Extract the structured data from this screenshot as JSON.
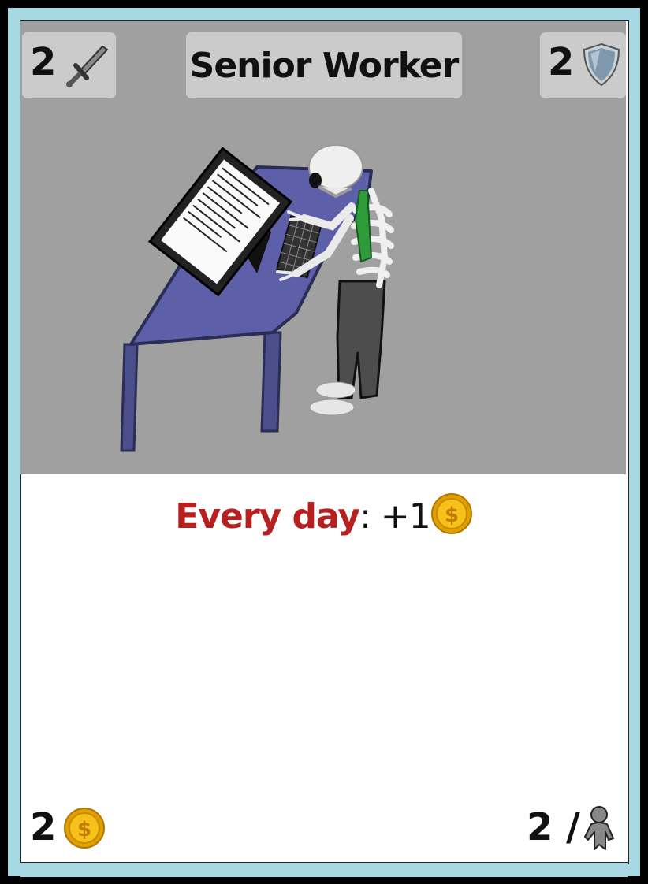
{
  "card": {
    "title": "Senior Worker",
    "attack": "2",
    "defense": "2",
    "ability_keyword": "Every day",
    "ability_text": ": +1",
    "cost": "2",
    "population": "2 /"
  },
  "icons": {
    "attack": "sword-icon",
    "defense": "shield-icon",
    "ability_resource": "gold-coin-icon",
    "cost": "gold-coin-icon",
    "population": "person-icon"
  },
  "colors": {
    "frame": "#a8d8e4",
    "art_background": "#a0a0a0",
    "stat_pill": "#cbcbcb",
    "keyword": "#b82020",
    "coin": "#f2b705"
  }
}
